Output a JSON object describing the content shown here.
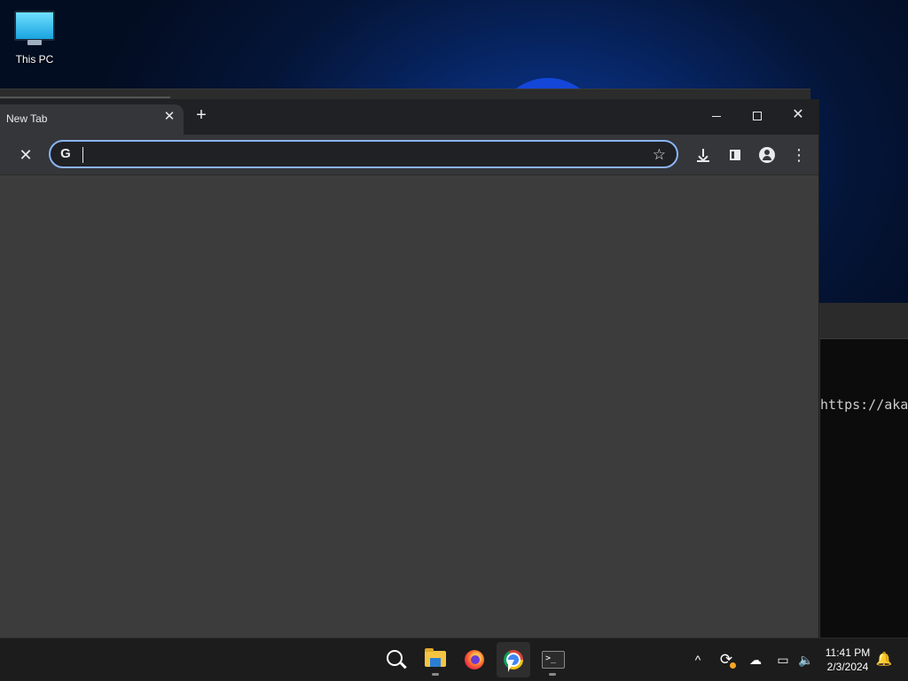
{
  "desktop": {
    "icons": [
      {
        "label": "This PC",
        "icon": "monitor-icon"
      }
    ]
  },
  "terminal_window": {
    "visible_text": "https://aka"
  },
  "browser": {
    "tab": {
      "title": "New Tab",
      "close_glyph": "✕"
    },
    "new_tab_glyph": "+",
    "window_controls": {
      "close_glyph": "✕"
    },
    "toolbar": {
      "stop_glyph": "✕",
      "omnibox_value": "",
      "omnibox_left_icon": "G",
      "bookmark_glyph": "☆",
      "menu_glyph": "⋮"
    },
    "accent_color": "#8ab4f8"
  },
  "taskbar": {
    "apps": [
      {
        "name": "Search",
        "icon": "search-icon"
      },
      {
        "name": "File Explorer",
        "icon": "folder-icon"
      },
      {
        "name": "Firefox",
        "icon": "firefox-icon"
      },
      {
        "name": "Google Chrome",
        "icon": "chrome-icon",
        "active": true
      },
      {
        "name": "Terminal",
        "icon": "terminal-icon"
      }
    ],
    "terminal_glyph": ">_",
    "tray": {
      "chevron_glyph": "^",
      "sync_glyph": "⟳",
      "cloud_glyph": "☁",
      "network_glyph": "▭",
      "volume_glyph": "🔈",
      "bell_glyph": "🔔"
    },
    "clock": {
      "time": "11:41 PM",
      "date": "2/3/2024"
    }
  }
}
